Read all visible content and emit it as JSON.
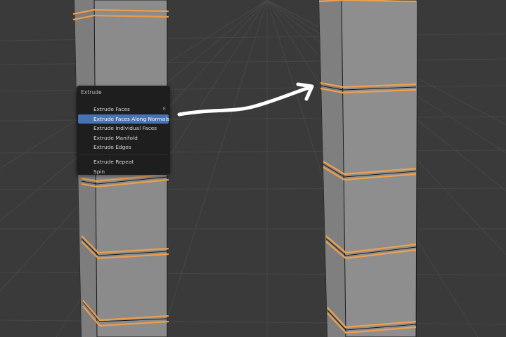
{
  "colors": {
    "background": "#3a3a3a",
    "grid": "#474747",
    "mesh_face": "#8e8e8e",
    "mesh_face_shade": "#7e7e7e",
    "selected_edge": "#f0a04b",
    "menu_background": "#1e1e1e",
    "menu_highlight": "#4772b3",
    "annotation_arrow": "#ffffff"
  },
  "menu": {
    "title": "Extrude",
    "items": [
      {
        "label": "Extrude Faces",
        "shortcut": "E"
      },
      {
        "label": "Extrude Faces Along Normals",
        "shortcut": "",
        "active": true
      },
      {
        "label": "Extrude Individual Faces",
        "shortcut": ""
      },
      {
        "label": "Extrude Manifold",
        "shortcut": ""
      },
      {
        "label": "Extrude Edges",
        "shortcut": ""
      }
    ],
    "secondary_items": [
      {
        "label": "Extrude Repeat"
      },
      {
        "label": "Spin"
      }
    ]
  },
  "annotation": {
    "icon": "curved-arrow-icon"
  }
}
